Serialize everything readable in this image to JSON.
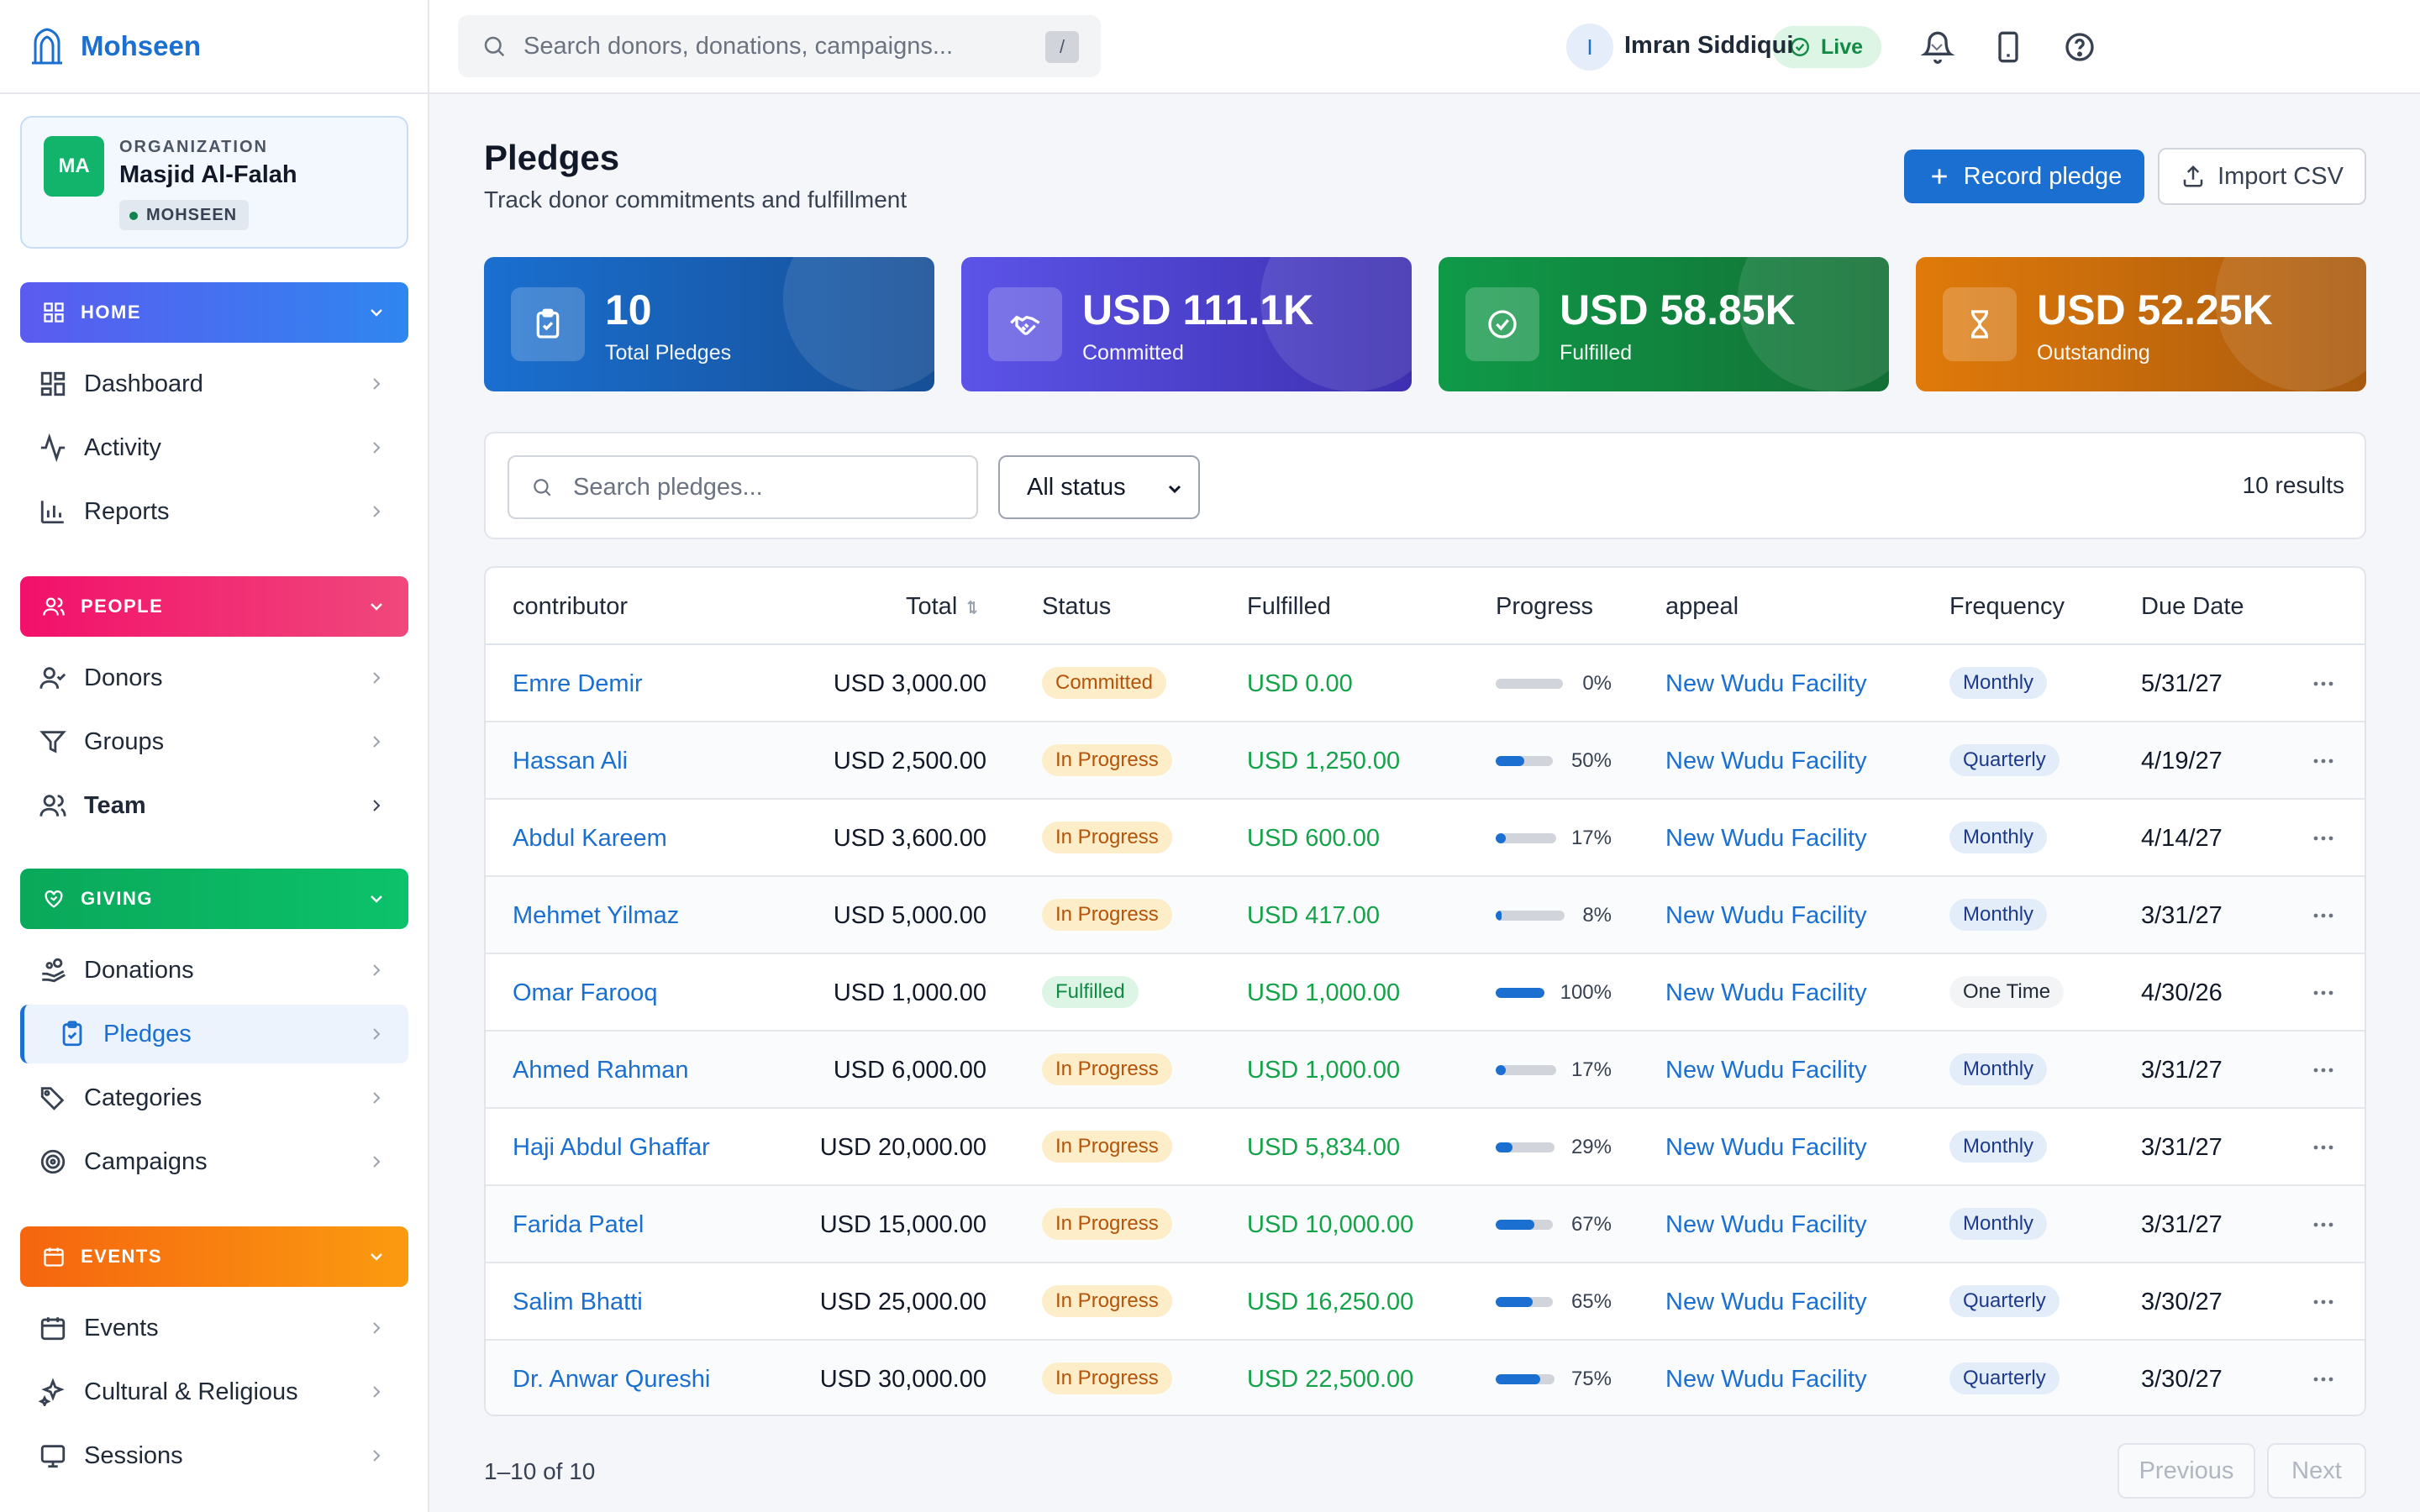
{
  "app": {
    "name": "Mohseen"
  },
  "org": {
    "label": "ORGANIZATION",
    "name": "Masjid Al-Falah",
    "initials": "MA",
    "badge": "MOHSEEN"
  },
  "sidebar": {
    "sections": [
      {
        "label": "HOME",
        "items": [
          {
            "label": "Dashboard"
          },
          {
            "label": "Activity"
          },
          {
            "label": "Reports"
          }
        ]
      },
      {
        "label": "PEOPLE",
        "items": [
          {
            "label": "Donors"
          },
          {
            "label": "Groups"
          },
          {
            "label": "Team"
          }
        ]
      },
      {
        "label": "GIVING",
        "items": [
          {
            "label": "Donations"
          },
          {
            "label": "Pledges"
          },
          {
            "label": "Categories"
          },
          {
            "label": "Campaigns"
          }
        ]
      },
      {
        "label": "EVENTS",
        "items": [
          {
            "label": "Events"
          },
          {
            "label": "Cultural & Religious"
          },
          {
            "label": "Sessions"
          }
        ]
      }
    ]
  },
  "topbar": {
    "search_placeholder": "Search donors, donations, campaigns...",
    "search_shortcut": "/",
    "status": "Live",
    "user_initial": "I",
    "user_name": "Imran Siddiqui"
  },
  "page": {
    "title": "Pledges",
    "subtitle": "Track donor commitments and fulfillment",
    "primary_button": "Record pledge",
    "secondary_button": "Import CSV"
  },
  "stats": [
    {
      "value": "10",
      "label": "Total Pledges",
      "color": "#1a6fd0"
    },
    {
      "value": "USD 111.1K",
      "label": "Committed",
      "color": "#5c54e8"
    },
    {
      "value": "USD 58.85K",
      "label": "Fulfilled",
      "color": "#0f9a48"
    },
    {
      "value": "USD 52.25K",
      "label": "Outstanding",
      "color": "#e07a0a"
    }
  ],
  "filters": {
    "search_placeholder": "Search pledges...",
    "status_selected": "All status",
    "result_count": "10 results"
  },
  "table": {
    "columns": {
      "contributor": "contributor",
      "total": "Total",
      "status": "Status",
      "fulfilled": "Fulfilled",
      "progress": "Progress",
      "appeal": "appeal",
      "frequency": "Frequency",
      "due": "Due Date"
    },
    "rows": [
      {
        "contributor": "Emre Demir",
        "total": "USD 3,000.00",
        "status": "Committed",
        "fulfilled": "USD 0.00",
        "progress": 0,
        "progress_label": "0%",
        "appeal": "New Wudu Facility",
        "frequency": "Monthly",
        "due": "5/31/27"
      },
      {
        "contributor": "Hassan Ali",
        "total": "USD 2,500.00",
        "status": "In Progress",
        "fulfilled": "USD 1,250.00",
        "progress": 50,
        "progress_label": "50%",
        "appeal": "New Wudu Facility",
        "frequency": "Quarterly",
        "due": "4/19/27"
      },
      {
        "contributor": "Abdul Kareem",
        "total": "USD 3,600.00",
        "status": "In Progress",
        "fulfilled": "USD 600.00",
        "progress": 17,
        "progress_label": "17%",
        "appeal": "New Wudu Facility",
        "frequency": "Monthly",
        "due": "4/14/27"
      },
      {
        "contributor": "Mehmet Yilmaz",
        "total": "USD 5,000.00",
        "status": "In Progress",
        "fulfilled": "USD 417.00",
        "progress": 8,
        "progress_label": "8%",
        "appeal": "New Wudu Facility",
        "frequency": "Monthly",
        "due": "3/31/27"
      },
      {
        "contributor": "Omar Farooq",
        "total": "USD 1,000.00",
        "status": "Fulfilled",
        "fulfilled": "USD 1,000.00",
        "progress": 100,
        "progress_label": "100%",
        "appeal": "New Wudu Facility",
        "frequency": "One Time",
        "due": "4/30/26"
      },
      {
        "contributor": "Ahmed Rahman",
        "total": "USD 6,000.00",
        "status": "In Progress",
        "fulfilled": "USD 1,000.00",
        "progress": 17,
        "progress_label": "17%",
        "appeal": "New Wudu Facility",
        "frequency": "Monthly",
        "due": "3/31/27"
      },
      {
        "contributor": "Haji Abdul Ghaffar",
        "total": "USD 20,000.00",
        "status": "In Progress",
        "fulfilled": "USD 5,834.00",
        "progress": 29,
        "progress_label": "29%",
        "appeal": "New Wudu Facility",
        "frequency": "Monthly",
        "due": "3/31/27"
      },
      {
        "contributor": "Farida Patel",
        "total": "USD 15,000.00",
        "status": "In Progress",
        "fulfilled": "USD 10,000.00",
        "progress": 67,
        "progress_label": "67%",
        "appeal": "New Wudu Facility",
        "frequency": "Monthly",
        "due": "3/31/27"
      },
      {
        "contributor": "Salim Bhatti",
        "total": "USD 25,000.00",
        "status": "In Progress",
        "fulfilled": "USD 16,250.00",
        "progress": 65,
        "progress_label": "65%",
        "appeal": "New Wudu Facility",
        "frequency": "Quarterly",
        "due": "3/30/27"
      },
      {
        "contributor": "Dr. Anwar Qureshi",
        "total": "USD 30,000.00",
        "status": "In Progress",
        "fulfilled": "USD 22,500.00",
        "progress": 75,
        "progress_label": "75%",
        "appeal": "New Wudu Facility",
        "frequency": "Quarterly",
        "due": "3/30/27"
      }
    ]
  },
  "pagination": {
    "info": "1–10 of 10",
    "previous": "Previous",
    "next": "Next"
  }
}
